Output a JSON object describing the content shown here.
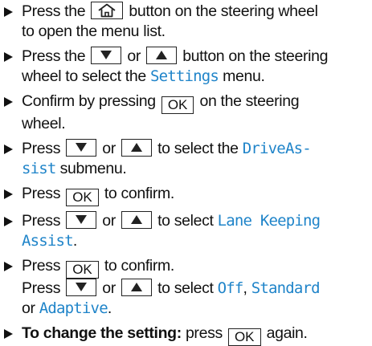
{
  "steps": [
    {
      "l1a": "Press the",
      "l1b": "button on the steering wheel",
      "l2": "to open the menu list."
    },
    {
      "l1a": "Press the",
      "l1b": "or",
      "l1c": "button on the steering",
      "l2a": "wheel to select the",
      "l2kw": "Settings",
      "l2b": "menu."
    },
    {
      "l1a": "Confirm by pressing",
      "l1b": "on the steering",
      "l2": "wheel."
    },
    {
      "l1a": "Press",
      "l1b": "or",
      "l1c": "to select the",
      "l1kw": "DriveAs-",
      "l2kw": "sist",
      "l2b": "submenu."
    },
    {
      "l1a": "Press",
      "l1b": "to confirm."
    },
    {
      "l1a": "Press",
      "l1b": "or",
      "l1c": "to select",
      "l1kw": "Lane Keeping",
      "l2kw": "Assist",
      "l2b": "."
    },
    {
      "l1a": "Press",
      "l1b": "to confirm.",
      "l2a": "Press",
      "l2b": "or",
      "l2c": "to select",
      "l2kw1": "Off",
      "l2sep": ",",
      "l2kw2": "Standard",
      "l3a": "or",
      "l3kw": "Adaptive",
      "l3b": "."
    },
    {
      "bold": "To change the setting:",
      "l1a": "press",
      "l1b": "again."
    }
  ],
  "buttons": {
    "ok": "OK"
  },
  "colors": {
    "keyword": "#1f84c9",
    "text": "#111111"
  },
  "icons": {
    "home": "home-icon",
    "down": "down-triangle-icon",
    "up": "up-triangle-icon",
    "bullet": "bullet-arrow-icon"
  }
}
